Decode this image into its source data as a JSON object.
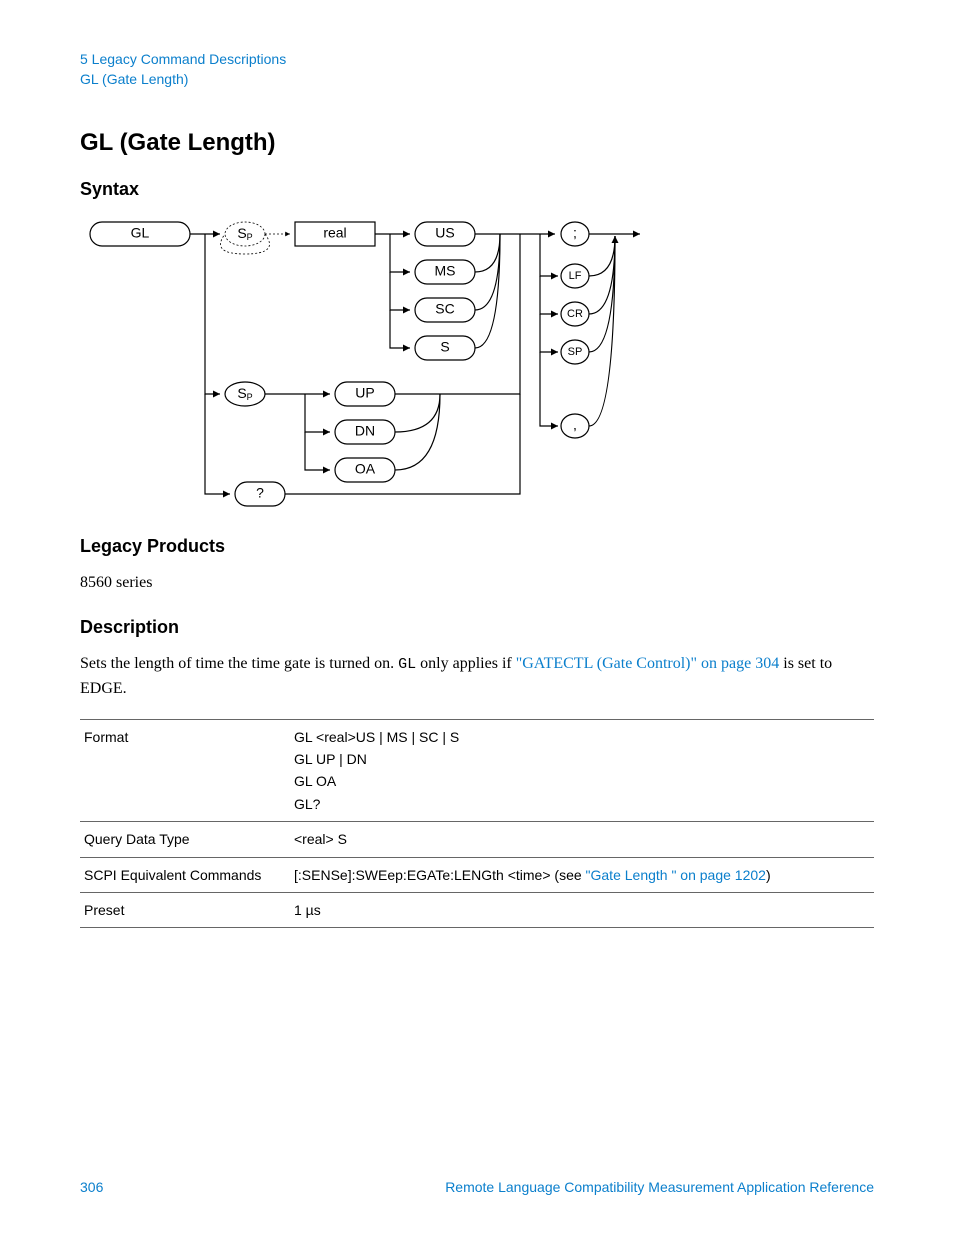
{
  "header": {
    "chapter_line": "5  Legacy Command Descriptions",
    "section_line": "GL (Gate Length)"
  },
  "title": "GL (Gate Length)",
  "sections": {
    "syntax": "Syntax",
    "legacy": "Legacy Products",
    "description": "Description"
  },
  "legacy_text": "8560 series",
  "description_text": {
    "pre": "Sets the length of time the time gate is turned on. ",
    "code": "GL",
    "mid": " only applies if ",
    "link": "\"GATECTL (Gate Control)\" on page 304",
    "post": " is set to EDGE."
  },
  "diagram": {
    "nodes": {
      "GL": "GL",
      "SP1": "S",
      "SPp1": "P",
      "real": "real",
      "US": "US",
      "MS": "MS",
      "SC": "SC",
      "S": "S",
      "semi": ";",
      "LF": "LF",
      "CR": "CR",
      "SP": "SP",
      "comma": ",",
      "SP2": "S",
      "SPp2": "P",
      "UP": "UP",
      "DN": "DN",
      "OA": "OA",
      "Q": "?"
    }
  },
  "table": {
    "rows": [
      {
        "label": "Format",
        "lines": [
          "GL <real>US | MS | SC | S",
          "GL UP | DN",
          "GL OA",
          "GL?"
        ]
      },
      {
        "label": "Query Data Type",
        "lines": [
          "<real> S"
        ]
      },
      {
        "label": "SCPI Equivalent Commands",
        "scpi_pre": "[:SENSe]:SWEep:EGATe:LENGth <time> (see ",
        "scpi_link": "\"Gate Length \" on page 1202",
        "scpi_post": ")"
      },
      {
        "label": "Preset",
        "lines": [
          "1 µs"
        ]
      }
    ]
  },
  "footer": {
    "page": "306",
    "doc": "Remote Language Compatibility Measurement Application Reference"
  }
}
